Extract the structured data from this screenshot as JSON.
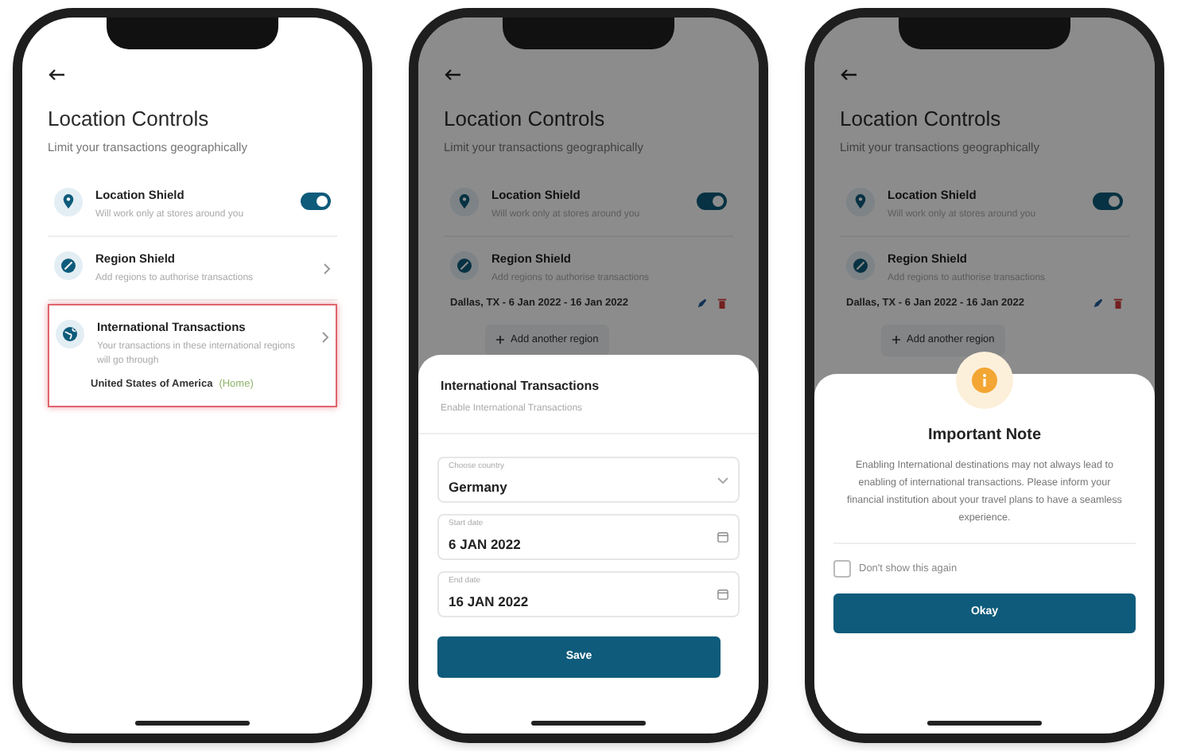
{
  "screens": [
    {
      "title": "Location Controls",
      "subtitle": "Limit your transactions geographically",
      "items": [
        {
          "kind": "toggle",
          "title": "Location Shield",
          "description": "Will work only at stores around you",
          "on": true,
          "highlighted": false
        },
        {
          "kind": "link",
          "title": "Region Shield",
          "description": "Add regions to authorise transactions",
          "highlighted": false
        },
        {
          "kind": "link",
          "title": "International Transactions",
          "description": "Your transactions in these international regions will go through",
          "value": "United States of America",
          "value_note": "(Home)",
          "highlighted": true
        }
      ]
    },
    {
      "title": "Location Controls",
      "subtitle": "Limit your transactions geographically",
      "items": [
        {
          "kind": "toggle",
          "title": "Location Shield",
          "description": "Will work only at stores around you",
          "on": true,
          "highlighted": false
        },
        {
          "kind": "regions",
          "title": "Region Shield",
          "description": "Add regions to authorise transactions",
          "regions": [
            "Dallas, TX - 6 Jan 2022 - 16 Jan 2022"
          ],
          "add_label": "Add another region",
          "highlighted": false
        }
      ],
      "sheet": {
        "kind": "form",
        "title": "International Transactions",
        "subtitle": "Enable International Transactions",
        "fields": [
          {
            "kind": "select",
            "label": "Choose country",
            "value": "Germany"
          },
          {
            "kind": "date",
            "label": "Start date",
            "value": "6 JAN 2022"
          },
          {
            "kind": "date",
            "label": "End date",
            "value": "16 JAN 2022"
          }
        ],
        "button": "Save"
      }
    },
    {
      "title": "Location Controls",
      "subtitle": "Limit your transactions geographically",
      "items": [
        {
          "kind": "toggle",
          "title": "Location Shield",
          "description": "Will work only at stores around you",
          "on": true,
          "highlighted": false
        },
        {
          "kind": "regions",
          "title": "Region Shield",
          "description": "Add regions to authorise transactions",
          "regions": [
            "Dallas, TX - 6 Jan 2022 - 16 Jan 2022"
          ],
          "add_label": "Add another region",
          "highlighted": false
        }
      ],
      "sheet": {
        "kind": "note",
        "title": "Important Note",
        "body": "Enabling International destinations may not always lead to enabling of international transactions. Please inform your financial institution about your travel plans to have a seamless experience.",
        "checkbox": {
          "label": "Don't show this again",
          "checked": false
        },
        "button": "Okay"
      }
    }
  ]
}
